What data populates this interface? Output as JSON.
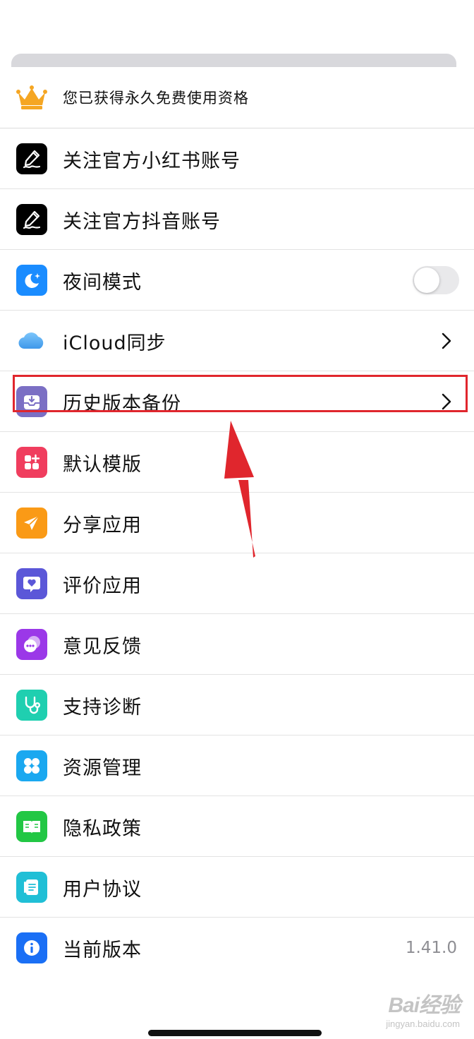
{
  "premium": {
    "label": "您已获得永久免费使用资格",
    "icon": "crown-icon",
    "icon_color": "#f5a623"
  },
  "settings": {
    "items": [
      {
        "label": "关注官方小红书账号",
        "icon": "pen-signature-icon",
        "icon_bg": "#000000",
        "accessory": "none"
      },
      {
        "label": "关注官方抖音账号",
        "icon": "pen-signature-icon",
        "icon_bg": "#000000",
        "accessory": "none"
      },
      {
        "label": "夜间模式",
        "icon": "moon-icon",
        "icon_bg": "#1a8cff",
        "accessory": "toggle",
        "toggle_on": false
      },
      {
        "label": "iCloud同步",
        "icon": "cloud-icon",
        "icon_bg": "#5ab0f5",
        "accessory": "chevron"
      },
      {
        "label": "历史版本备份",
        "icon": "backup-tray-icon",
        "icon_bg": "#7b6fc4",
        "accessory": "chevron",
        "highlighted": true
      },
      {
        "label": "默认模版",
        "icon": "grid-plus-icon",
        "icon_bg": "#f03d5e",
        "accessory": "none"
      },
      {
        "label": "分享应用",
        "icon": "paper-plane-icon",
        "icon_bg": "#fa9a16",
        "accessory": "none"
      },
      {
        "label": "评价应用",
        "icon": "heart-message-icon",
        "icon_bg": "#5b57d8",
        "accessory": "none"
      },
      {
        "label": "意见反馈",
        "icon": "chat-bubbles-icon",
        "icon_bg": "#9b38e8",
        "accessory": "none"
      },
      {
        "label": "支持诊断",
        "icon": "stethoscope-icon",
        "icon_bg": "#1fcfb0",
        "accessory": "none"
      },
      {
        "label": "资源管理",
        "icon": "four-petal-icon",
        "icon_bg": "#1aa8f0",
        "accessory": "none"
      },
      {
        "label": "隐私政策",
        "icon": "open-book-icon",
        "icon_bg": "#22c744",
        "accessory": "none"
      },
      {
        "label": "用户协议",
        "icon": "document-icon",
        "icon_bg": "#20bfd6",
        "accessory": "none"
      },
      {
        "label": "当前版本",
        "icon": "info-icon",
        "icon_bg": "#1a6ff5",
        "accessory": "value",
        "value": "1.41.0"
      }
    ]
  },
  "annotation": {
    "color": "#e0262d"
  },
  "watermark": {
    "logo": "Bai经验",
    "url": "jingyan.baidu.com"
  }
}
